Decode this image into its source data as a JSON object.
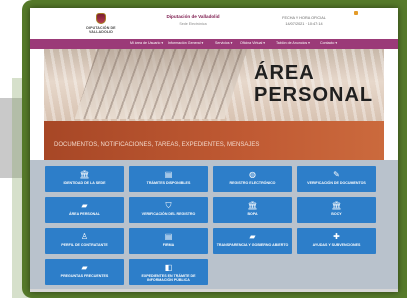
{
  "header": {
    "logo_text": "DIPUTACIÓN DE VALLADOLID",
    "title": "Diputación de Valladolid",
    "subtitle": "Sede Electrónica",
    "date_label": "FECHA Y HORA OFICIAL",
    "datetime": "14/07/2021 · 10:47:14"
  },
  "nav": {
    "items": [
      "Mi área de Usuario ▾",
      "Información General ▾",
      "Servicios ▾",
      "Oficina Virtual ▾",
      "Tablón de Anuncios ▾",
      "Contacto ▾"
    ]
  },
  "banner": {
    "title_line1": "ÁREA",
    "title_line2": "PERSONAL",
    "subtitle": "DOCUMENTOS, NOTIFICACIONES, TAREAS, EXPEDIENTES, MENSAJES"
  },
  "tiles": [
    {
      "label": "IDENTIDAD DE LA SEDE",
      "icon": "building-icon",
      "glyph": "🏛"
    },
    {
      "label": "TRÁMITES DISPONIBLES",
      "icon": "document-icon",
      "glyph": "▤"
    },
    {
      "label": "REGISTRO ELECTRÓNICO",
      "icon": "stamp-icon",
      "glyph": "◍"
    },
    {
      "label": "VERIFICACIÓN DE DOCUMENTOS",
      "icon": "check-doc-icon",
      "glyph": "✎"
    },
    {
      "label": "ÁREA PERSONAL",
      "icon": "folder-icon",
      "glyph": "▰"
    },
    {
      "label": "VERIFICACIÓN DEL REGISTRO",
      "icon": "shield-icon",
      "glyph": "⛉"
    },
    {
      "label": "BOPA",
      "icon": "building-icon",
      "glyph": "🏛"
    },
    {
      "label": "BOCY",
      "icon": "building-icon",
      "glyph": "🏛"
    },
    {
      "label": "PERFIL DE CONTRATANTE",
      "icon": "person-icon",
      "glyph": "♙"
    },
    {
      "label": "FIRMA",
      "icon": "list-icon",
      "glyph": "▤"
    },
    {
      "label": "TRANSPARENCIA Y GOBIERNO ABIERTO",
      "icon": "chat-icon",
      "glyph": "▰"
    },
    {
      "label": "AYUDAS Y SUBVENCIONES",
      "icon": "puzzle-icon",
      "glyph": "✚"
    },
    {
      "label": "PREGUNTAS FRECUENTES",
      "icon": "chat-icon",
      "glyph": "▰"
    },
    {
      "label": "EXPEDIENTES EN TRÁMITE DE INFORMACIÓN PÚBLICA",
      "icon": "book-icon",
      "glyph": "◧"
    }
  ],
  "colors": {
    "frame_green": "#567a2a",
    "nav_purple": "#9b3a78",
    "tile_blue": "#2d7ec9",
    "banner_orange": "#b5502c"
  }
}
